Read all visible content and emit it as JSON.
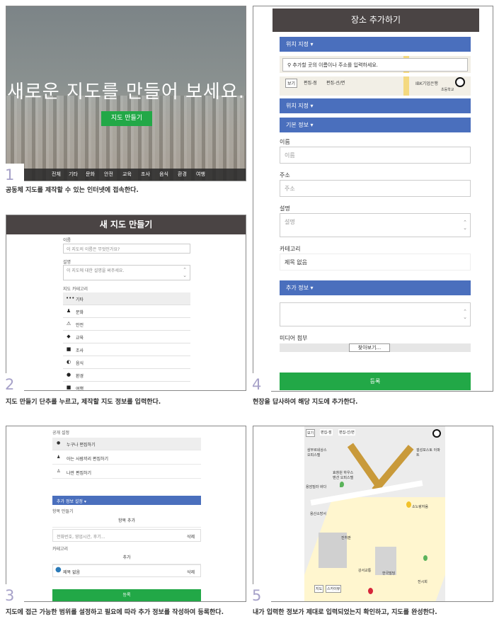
{
  "panel1": {
    "number": "1",
    "hero_title": "새로운 지도를 만들어 보세요.",
    "cta_label": "지도 만들기",
    "nav": [
      "전체",
      "기타",
      "문화",
      "안전",
      "교육",
      "조사",
      "음식",
      "환경",
      "여행"
    ],
    "caption": "공동체 지도를 제작할 수 있는 인터넷에 접속한다."
  },
  "panel2": {
    "number": "2",
    "header": "새 지도 만들기",
    "name_label": "이름",
    "name_placeholder": "이 지도의 이름은 무엇인가요?",
    "desc_label": "설명",
    "desc_placeholder": "이 지도에 대한 설명을 써주세요.",
    "category_label": "지도 카테고리",
    "categories": [
      {
        "icon": "dots-icon",
        "label": "기타"
      },
      {
        "icon": "people-icon",
        "label": "문화"
      },
      {
        "icon": "warning-icon",
        "label": "안전"
      },
      {
        "icon": "graduation-icon",
        "label": "교육"
      },
      {
        "icon": "chat-icon",
        "label": "조사"
      },
      {
        "icon": "food-icon",
        "label": "음식"
      },
      {
        "icon": "globe-icon",
        "label": "환경"
      },
      {
        "icon": "suitcase-icon",
        "label": "여행"
      }
    ],
    "caption": "지도 만들기 단추를 누르고, 제작할 지도 정보를 입력한다."
  },
  "panel3": {
    "number": "3",
    "public_label": "공개 설정",
    "options": [
      "누구나 편집하기",
      "아는 사람끼리 편집하기",
      "나만 편집하기"
    ],
    "extra_header": "추가 정보 설정 ▾",
    "item_label": "항목 만들기",
    "add_item": "항목 추가",
    "item_placeholder": "전화번호, 영업시간, 후기...",
    "delete1": "삭제",
    "category_label": "카테고리",
    "add": "추가",
    "category_value": "제목 없음",
    "delete2": "삭제",
    "submit": "등록",
    "caption": "지도에 접근 가능한 범위를 설정하고 필요에 따라 추가 정보를 작성하여 등록한다."
  },
  "panel4": {
    "number": "4",
    "header": "장소 추가하기",
    "location_btn": "위치 지정 ▾",
    "search_placeholder": "추가할 곳의 이름이나 주소를 입력하세요.",
    "map_tabs": [
      "보기",
      "편집-점",
      "편집-선/면"
    ],
    "map_poi": "IBK기업은행",
    "map_poi2": "초등학교",
    "location_btn2": "위치 지정 ▾",
    "basic_btn": "기본 정보 ▾",
    "name_label": "이름",
    "name_placeholder": "이름",
    "addr_label": "주소",
    "addr_placeholder": "주소",
    "desc_label": "설명",
    "desc_placeholder": "설명",
    "cat_label": "카테고리",
    "cat_value": "제목 없음",
    "extra_btn": "추가 정보 ▾",
    "media_label": "미디어 첨부",
    "browse": "찾아보기...",
    "submit": "등록",
    "caption": "현장을 답사하여 해당 지도에 추가한다."
  },
  "panel5": {
    "number": "5",
    "map_tabs": [
      "보기",
      "편집-점",
      "편집-선/면"
    ],
    "labels": [
      "삼부르네상스 오피스텔",
      "효창원 하우스 맨션 오피스텔",
      "용암빌라 바다",
      "소노랑자움",
      "진허판",
      "용산소방서",
      "강서교통",
      "한국빌딩",
      "갤성포스토 아파트",
      "전시회"
    ],
    "map_btn": "지도",
    "sat_btn": "스카이뷰",
    "caption": "내가 입력한 정보가 제대로 입력되었는지 확인하고, 지도를 완성한다."
  }
}
